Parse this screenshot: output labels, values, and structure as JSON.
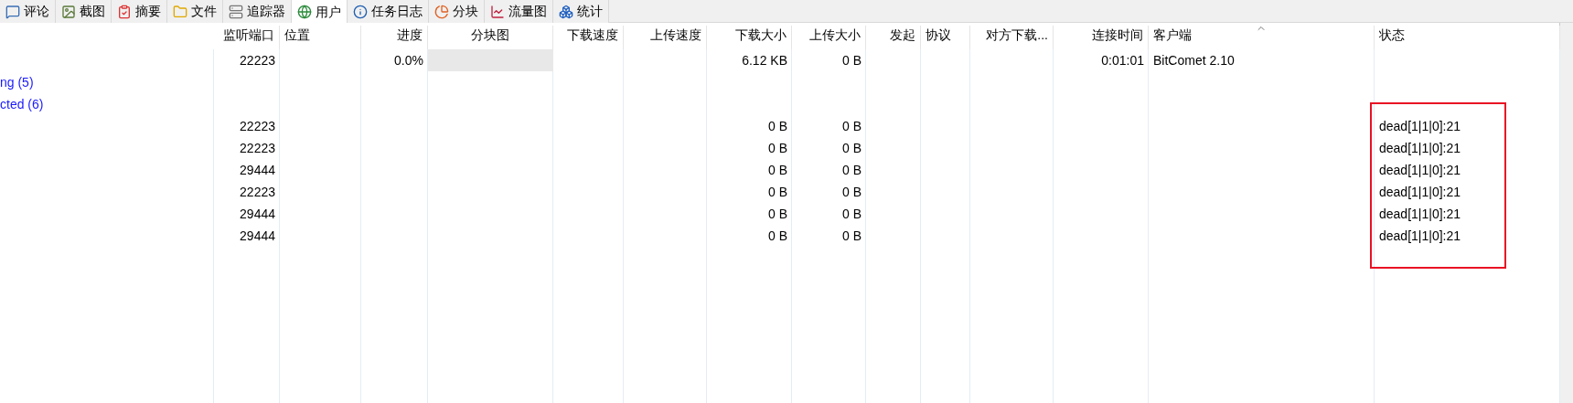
{
  "tabs": [
    {
      "label": "评论",
      "selected": false
    },
    {
      "label": "截图",
      "selected": false
    },
    {
      "label": "摘要",
      "selected": false
    },
    {
      "label": "文件",
      "selected": false
    },
    {
      "label": "追踪器",
      "selected": false
    },
    {
      "label": "用户",
      "selected": true
    },
    {
      "label": "任务日志",
      "selected": false
    },
    {
      "label": "分块",
      "selected": false
    },
    {
      "label": "流量图",
      "selected": false
    },
    {
      "label": "统计",
      "selected": false
    }
  ],
  "table": {
    "columns": [
      {
        "label": "监听端口",
        "sorted": false
      },
      {
        "label": "位置",
        "sorted": false
      },
      {
        "label": "进度",
        "sorted": false
      },
      {
        "label": "分块图",
        "sorted": false
      },
      {
        "label": "下载速度",
        "sorted": false
      },
      {
        "label": "上传速度",
        "sorted": false
      },
      {
        "label": "下载大小",
        "sorted": false
      },
      {
        "label": "上传大小",
        "sorted": false
      },
      {
        "label": "发起",
        "sorted": false
      },
      {
        "label": "协议",
        "sorted": false
      },
      {
        "label": "对方下载...",
        "sorted": false
      },
      {
        "label": "连接时间",
        "sorted": false
      },
      {
        "label": "客户端",
        "sorted": true
      },
      {
        "label": "状态",
        "sorted": false
      }
    ],
    "rows": [
      {
        "kind": "connected_peer",
        "highlighted": false,
        "cells": [
          "22223",
          null,
          "0.0%",
          null,
          null,
          null,
          "6.12 KB",
          "0 B",
          null,
          null,
          null,
          "0:01:01",
          "BitComet 2.10",
          null
        ]
      },
      {
        "kind": "group",
        "label": "ng (5)"
      },
      {
        "kind": "group",
        "label": "cted (6)"
      },
      {
        "kind": "peer",
        "highlighted": true,
        "cells": [
          "22223",
          null,
          null,
          null,
          null,
          null,
          "0 B",
          "0 B",
          null,
          null,
          null,
          null,
          null,
          "dead[1|1|0]:21"
        ]
      },
      {
        "kind": "peer",
        "highlighted": true,
        "cells": [
          "22223",
          null,
          null,
          null,
          null,
          null,
          "0 B",
          "0 B",
          null,
          null,
          null,
          null,
          null,
          "dead[1|1|0]:21"
        ]
      },
      {
        "kind": "peer",
        "highlighted": true,
        "cells": [
          "29444",
          null,
          null,
          null,
          null,
          null,
          "0 B",
          "0 B",
          null,
          null,
          null,
          null,
          null,
          "dead[1|1|0]:21"
        ]
      },
      {
        "kind": "peer",
        "highlighted": true,
        "cells": [
          "22223",
          null,
          null,
          null,
          null,
          null,
          "0 B",
          "0 B",
          null,
          null,
          null,
          null,
          null,
          "dead[1|1|0]:21"
        ]
      },
      {
        "kind": "peer",
        "highlighted": true,
        "cells": [
          "29444",
          null,
          null,
          null,
          null,
          null,
          "0 B",
          "0 B",
          null,
          null,
          null,
          null,
          null,
          "dead[1|1|0]:21"
        ]
      },
      {
        "kind": "peer",
        "highlighted": true,
        "cells": [
          "29444",
          null,
          null,
          null,
          null,
          null,
          "0 B",
          "0 B",
          null,
          null,
          null,
          null,
          null,
          "dead[1|1|0]:21"
        ]
      }
    ]
  }
}
